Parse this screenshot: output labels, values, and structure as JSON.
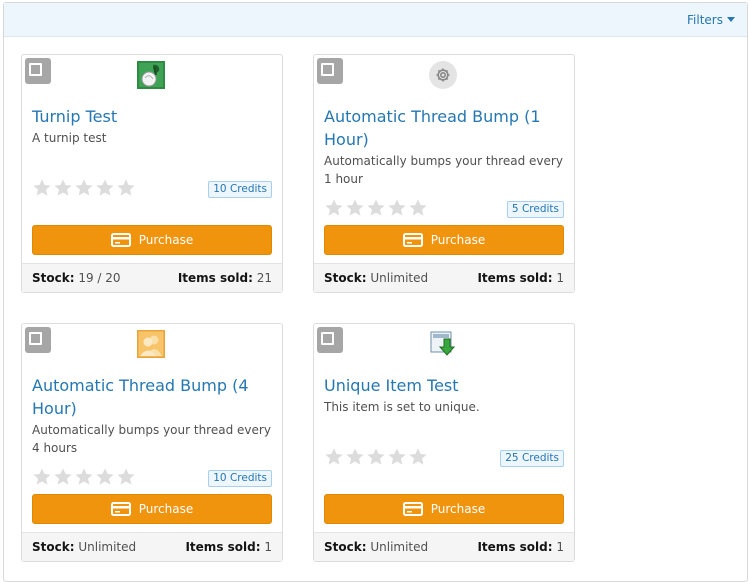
{
  "toolbar": {
    "filters_label": "Filters",
    "filters_icon": "caret-down-icon"
  },
  "common": {
    "purchase_label": "Purchase",
    "stock_label": "Stock:",
    "items_sold_label": "Items sold:",
    "rating_max": 5
  },
  "items": [
    {
      "title": "Turnip Test",
      "description": "A turnip test",
      "rating": 0,
      "price": "10 Credits",
      "stock": "19 / 20",
      "items_sold": "21",
      "icon": "turnip-icon"
    },
    {
      "title": "Automatic Thread Bump (1 Hour)",
      "description": "Automatically bumps your thread every 1 hour",
      "rating": 0,
      "price": "5 Credits",
      "stock": "Unlimited",
      "items_sold": "1",
      "icon": "gear-icon"
    },
    {
      "title": "Automatic Thread Bump (4 Hour)",
      "description": "Automatically bumps your thread every 4 hours",
      "rating": 0,
      "price": "10 Credits",
      "stock": "Unlimited",
      "items_sold": "1",
      "icon": "users-icon"
    },
    {
      "title": "Unique Item Test",
      "description": "This item is set to unique.",
      "rating": 0,
      "price": "25 Credits",
      "stock": "Unlimited",
      "items_sold": "1",
      "icon": "download-icon"
    }
  ],
  "colors": {
    "accent": "#2577b1",
    "purchase_button": "#f0930d",
    "star_empty": "#dcdcdc",
    "checkbox": "#a6a6a6"
  }
}
